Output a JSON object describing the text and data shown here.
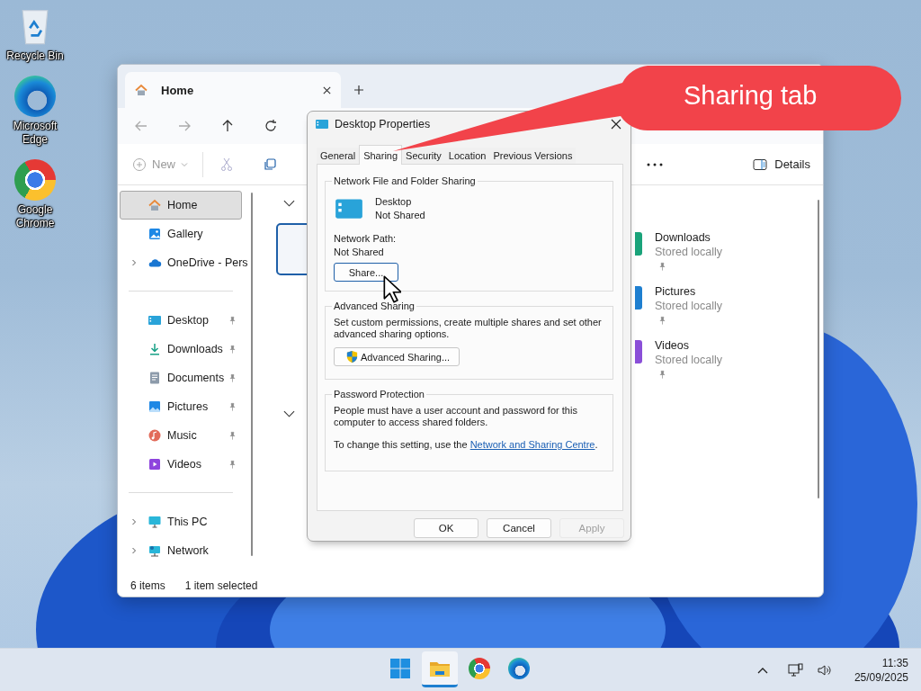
{
  "desktop_icons": [
    {
      "label": "Recycle Bin",
      "kind": "recycle"
    },
    {
      "label": "Microsoft Edge",
      "kind": "edge"
    },
    {
      "label": "Google Chrome",
      "kind": "chrome"
    }
  ],
  "explorer": {
    "tabs": [
      {
        "label": "Home",
        "selected": true
      }
    ],
    "toolbar": {
      "new_label": "New",
      "details_label": "Details"
    },
    "sidebar": {
      "top": [
        {
          "label": "Home",
          "kind": "home",
          "selected": true,
          "expandable": false
        },
        {
          "label": "Gallery",
          "kind": "gallery",
          "selected": false,
          "expandable": false
        },
        {
          "label": "OneDrive - Pers",
          "kind": "cloud",
          "selected": false,
          "expandable": true
        }
      ],
      "quick": [
        {
          "label": "Desktop",
          "kind": "desktop",
          "selected": false,
          "pinned": true
        },
        {
          "label": "Downloads",
          "kind": "download",
          "selected": false,
          "pinned": true
        },
        {
          "label": "Documents",
          "kind": "document",
          "selected": false,
          "pinned": true
        },
        {
          "label": "Pictures",
          "kind": "picture",
          "selected": false,
          "pinned": true
        },
        {
          "label": "Music",
          "kind": "music",
          "selected": false,
          "pinned": true
        },
        {
          "label": "Videos",
          "kind": "video",
          "selected": false,
          "pinned": true
        }
      ],
      "bottom": [
        {
          "label": "This PC",
          "kind": "pc",
          "selected": false,
          "expandable": true
        },
        {
          "label": "Network",
          "kind": "network",
          "selected": false,
          "expandable": true
        }
      ]
    },
    "content": {
      "items": [
        {
          "name": "Downloads",
          "status": "Stored locally",
          "color": "#1aa37a",
          "pinned": true
        },
        {
          "name": "Pictures",
          "status": "Stored locally",
          "color": "#1e7fd0",
          "pinned": true
        },
        {
          "name": "Videos",
          "status": "Stored locally",
          "color": "#8a4fd8",
          "pinned": true
        }
      ]
    },
    "status_bar": {
      "count": "6 items",
      "selection": "1 item selected"
    }
  },
  "dialog": {
    "title": "Desktop Properties",
    "tabs": [
      {
        "label": "General",
        "selected": false
      },
      {
        "label": "Sharing",
        "selected": true
      },
      {
        "label": "Security",
        "selected": false
      },
      {
        "label": "Location",
        "selected": false
      },
      {
        "label": "Previous Versions",
        "selected": false
      }
    ],
    "network_sharing": {
      "title": "Network File and Folder Sharing",
      "folder_name": "Desktop",
      "folder_status": "Not Shared",
      "path_label": "Network Path:",
      "path_value": "Not Shared",
      "button": "Share..."
    },
    "advanced_sharing": {
      "title": "Advanced Sharing",
      "description": "Set custom permissions, create multiple shares and set other advanced sharing options.",
      "button": "Advanced Sharing..."
    },
    "password_protection": {
      "title": "Password Protection",
      "text": "People must have a user account and password for this computer to access shared folders.",
      "change_prefix": "To change this setting, use the",
      "link": "Network and Sharing Centre",
      "change_suffix": "."
    },
    "buttons": [
      {
        "label": "OK",
        "disabled": false
      },
      {
        "label": "Cancel",
        "disabled": false
      },
      {
        "label": "Apply",
        "disabled": true
      }
    ]
  },
  "callout": {
    "text": "Sharing tab"
  },
  "taskbar": {
    "apps": [
      {
        "kind": "start",
        "selected": false
      },
      {
        "kind": "folder",
        "selected": true
      },
      {
        "kind": "chrome",
        "selected": false
      },
      {
        "kind": "edge",
        "selected": false
      }
    ],
    "time": "11:35",
    "date": "25/09/2025"
  }
}
